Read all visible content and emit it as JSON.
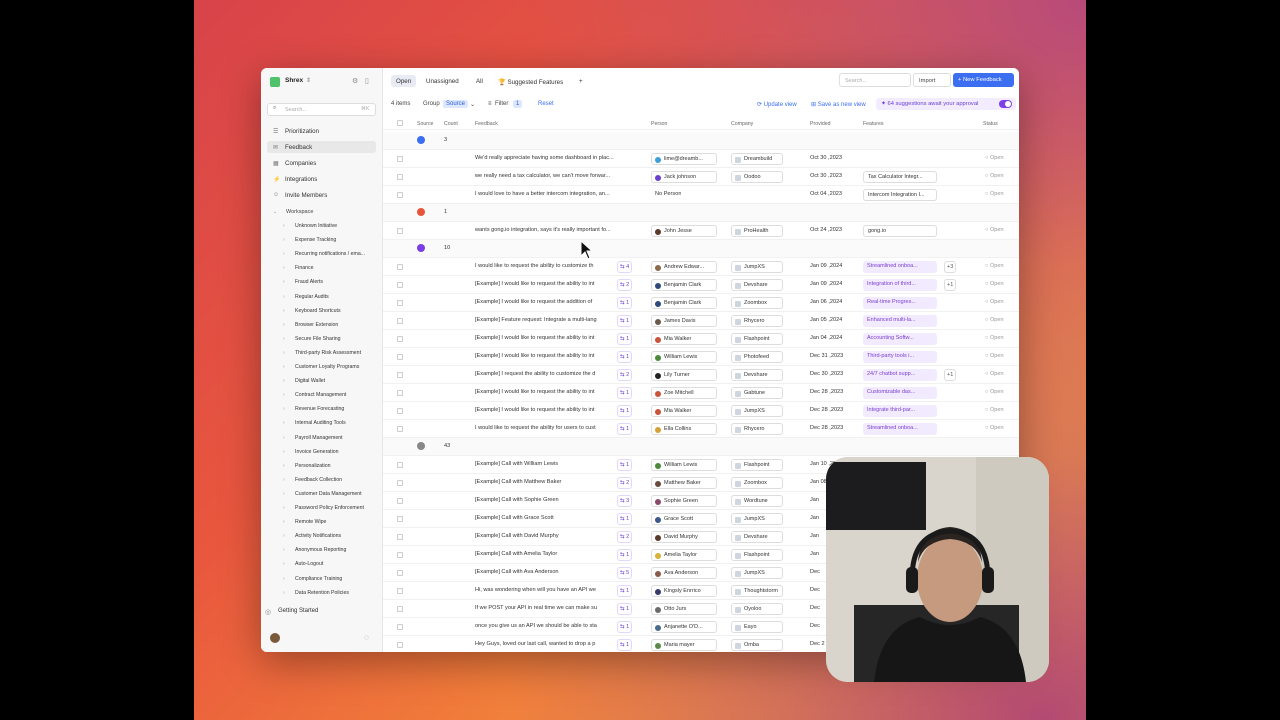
{
  "workspace": {
    "name": "Shrex"
  },
  "sidebar": {
    "search_placeholder": "Search...",
    "search_kbd": "⌘K",
    "nav": [
      {
        "label": "Prioritization",
        "icon": "list-icon"
      },
      {
        "label": "Feedback",
        "icon": "chat-icon",
        "active": true
      },
      {
        "label": "Companies",
        "icon": "building-icon"
      },
      {
        "label": "Integrations",
        "icon": "plug-icon"
      },
      {
        "label": "Invite Members",
        "icon": "user-plus-icon"
      }
    ],
    "workspace_label": "Workspace",
    "tree": [
      "Unknown Initiative",
      "Expense Tracking",
      "Recurring notifications / ema...",
      "Finance",
      "Fraud Alerts",
      "Regular Audits",
      "Keyboard Shortcuts",
      "Browser Extension",
      "Secure File Sharing",
      "Third-party Risk Assessment",
      "Customer Loyalty Programs",
      "Digital Wallet",
      "Contract Management",
      "Revenue Forecasting",
      "Internal Auditing Tools",
      "Payroll Management",
      "Invoice Generation",
      "Personalization",
      "Feedback Collection",
      "Customer Data Management",
      "Password Policy Enforcement",
      "Remote Wipe",
      "Activity Notifications",
      "Anonymous Reporting",
      "Auto-Logout",
      "Compliance Training",
      "Data Retention Policies"
    ],
    "getting_started": "Getting Started"
  },
  "tabs": [
    "Open",
    "Unassigned",
    "All",
    "Suggested Features"
  ],
  "tab_add": "+",
  "top": {
    "search_placeholder": "Search...",
    "import_label": "Import",
    "new_label": "+ New Feedback"
  },
  "toolbar": {
    "items_count": "4 items",
    "group_label": "Group",
    "group_value": "Source",
    "filter_label": "Filter",
    "filter_count": "1",
    "reset_label": "Reset",
    "update_view": "Update view",
    "save_view": "Save as new view",
    "suggestions": "64 suggestions await your approval"
  },
  "columns": [
    "Source",
    "Count",
    "Feedback",
    "Person",
    "Company",
    "Provided",
    "Features",
    "Status"
  ],
  "rows": [
    {
      "group": true,
      "count": "3",
      "src_color": "#3b6ef0"
    },
    {
      "feedback": "We'd really appreciate having some dashboard in plac...",
      "person": "lime@dreamb...",
      "pcolor": "#3aa0d8",
      "company": "Dreambuild",
      "date": "Oct 30 ,2023",
      "features": "",
      "status": "Open"
    },
    {
      "feedback": "we really need a tax calculator, we can't move forwar...",
      "person": "Jack johnson",
      "pcolor": "#6a3fd0",
      "company": "Oodoo",
      "date": "Oct 30 ,2023",
      "features": "Tax Calculator Integr...",
      "fplain": true,
      "status": "Open"
    },
    {
      "feedback": "I would love to have a better intercom integration, an...",
      "person": "No Person",
      "pcolor": "",
      "company": "",
      "date": "Oct 04 ,2023",
      "features": "Intercom Integration I...",
      "fplain": true,
      "status": "Open"
    },
    {
      "group": true,
      "count": "1",
      "src_color": "#e8553a"
    },
    {
      "feedback": "wants gong.io integration, says it's really important fo...",
      "person": "John Jesse",
      "pcolor": "#5a3a2a",
      "company": "ProHealth",
      "date": "Oct 24 ,2023",
      "features": "gong.io",
      "fplain": true,
      "status": "Open"
    },
    {
      "group": true,
      "count": "10",
      "src_color": "#7a3fe6"
    },
    {
      "feedback": "I would like to request the ability to customize th",
      "cnt": "4",
      "person": "Andrew Edwar...",
      "pcolor": "#8a6a4a",
      "company": "JumpXS",
      "date": "Jan 09 ,2024",
      "features": "Streamlined onboa...",
      "plus": "+3",
      "status": "Open"
    },
    {
      "feedback": "[Example] I would like to request the ability to int",
      "cnt": "2",
      "person": "Benjamin Clark",
      "pcolor": "#2f4a7a",
      "company": "Devshare",
      "date": "Jan 09 ,2024",
      "features": "Integration of third...",
      "plus": "+1",
      "status": "Open"
    },
    {
      "feedback": "[Example] I would like to request the addition of",
      "cnt": "1",
      "person": "Benjamin Clark",
      "pcolor": "#2f4a7a",
      "company": "Zoombox",
      "date": "Jan 06 ,2024",
      "features": "Real-time Progres...",
      "status": "Open"
    },
    {
      "feedback": "[Example] Feature request: Integrate a multi-lang",
      "cnt": "1",
      "person": "James Davis",
      "pcolor": "#6a5a4a",
      "company": "Rhycero",
      "date": "Jan 05 ,2024",
      "features": "Enhanced multi-la...",
      "status": "Open"
    },
    {
      "feedback": "[Example] I would like to request the ability to int",
      "cnt": "1",
      "person": "Mia Walker",
      "pcolor": "#c8553a",
      "company": "Flashpoint",
      "date": "Jan 04 ,2024",
      "features": "Accounting Softw...",
      "status": "Open"
    },
    {
      "feedback": "[Example] I would like to request the ability to int",
      "cnt": "1",
      "person": "William Lewis",
      "pcolor": "#4a8a3a",
      "company": "Photofeed",
      "date": "Dec 31 ,2023",
      "features": "Third-party tools i...",
      "status": "Open"
    },
    {
      "feedback": "[Example] I request the ability to customize the d",
      "cnt": "2",
      "person": "Lily Turner",
      "pcolor": "#222222",
      "company": "Devshare",
      "date": "Dec 30 ,2023",
      "features": "24/7 chatbot supp...",
      "plus": "+1",
      "status": "Open"
    },
    {
      "feedback": "[Example] I would like to request the ability to int",
      "cnt": "1",
      "person": "Zoe Mitchell",
      "pcolor": "#c8553a",
      "company": "Gabtune",
      "date": "Dec 28 ,2023",
      "features": "Customizable das...",
      "status": "Open"
    },
    {
      "feedback": "[Example] I would like to request the ability to int",
      "cnt": "1",
      "person": "Mia Walker",
      "pcolor": "#c8553a",
      "company": "JumpXS",
      "date": "Dec 28 ,2023",
      "features": "Integrate third-par...",
      "status": "Open"
    },
    {
      "feedback": "I would like to request the ability for users to cust",
      "cnt": "1",
      "person": "Ella Collins",
      "pcolor": "#d8a03a",
      "company": "Rhycero",
      "date": "Dec 28 ,2023",
      "features": "Streamlined onboa...",
      "status": "Open"
    },
    {
      "group": true,
      "count": "43",
      "src_color": "#888888"
    },
    {
      "feedback": "[Example] Call with William Lewis",
      "cnt": "1",
      "person": "William Lewis",
      "pcolor": "#4a8a3a",
      "company": "Flashpoint",
      "date": "Jan 10 ,2024",
      "features": "",
      "status": ""
    },
    {
      "feedback": "[Example] Call with Matthew Baker",
      "cnt": "2",
      "person": "Matthew Baker",
      "pcolor": "#6a4a3a",
      "company": "Zoombox",
      "date": "Jan 08",
      "features": "",
      "status": ""
    },
    {
      "feedback": "[Example] Call with Sophie Green",
      "cnt": "3",
      "person": "Sophie Green",
      "pcolor": "#8a4a6a",
      "company": "Wordtune",
      "date": "Jan",
      "features": "",
      "status": ""
    },
    {
      "feedback": "[Example] Call with Grace Scott",
      "cnt": "1",
      "person": "Grace Scott",
      "pcolor": "#3a5a8a",
      "company": "JumpXS",
      "date": "Jan",
      "features": "",
      "status": ""
    },
    {
      "feedback": "[Example] Call with David Murphy",
      "cnt": "2",
      "person": "David Murphy",
      "pcolor": "#5a3a2a",
      "company": "Devshare",
      "date": "Jan",
      "features": "",
      "status": ""
    },
    {
      "feedback": "[Example] Call with Amelia Taylor",
      "cnt": "1",
      "person": "Amelia Taylor",
      "pcolor": "#d8b03a",
      "company": "Flashpoint",
      "date": "Jan",
      "features": "",
      "status": ""
    },
    {
      "feedback": "[Example] Call with Ava Anderson",
      "cnt": "5",
      "person": "Ava Anderson",
      "pcolor": "#8a5a4a",
      "company": "JumpXS",
      "date": "Dec",
      "features": "",
      "status": ""
    },
    {
      "feedback": "Hi, was wondering when will you have an API we",
      "cnt": "1",
      "person": "Kingsly Enrrico",
      "pcolor": "#3a3a6a",
      "company": "Thoughtstorm",
      "date": "Dec",
      "features": "",
      "status": ""
    },
    {
      "feedback": "If we POST your API in real time we can make su",
      "cnt": "1",
      "person": "Otto Jurs",
      "pcolor": "#6a6a6a",
      "company": "Oyoloo",
      "date": "Dec",
      "features": "",
      "status": ""
    },
    {
      "feedback": "once you give us an API we should be able to sta",
      "cnt": "1",
      "person": "Anjanette O'D...",
      "pcolor": "#4a6a8a",
      "company": "Eayo",
      "date": "Dec",
      "features": "",
      "status": ""
    },
    {
      "feedback": "Hey Guys, loved our last call, wanted to drop a p",
      "cnt": "1",
      "person": "Maria mayer",
      "pcolor": "#5a8a4a",
      "company": "Omba",
      "date": "Dec 2",
      "features": "",
      "status": ""
    }
  ]
}
